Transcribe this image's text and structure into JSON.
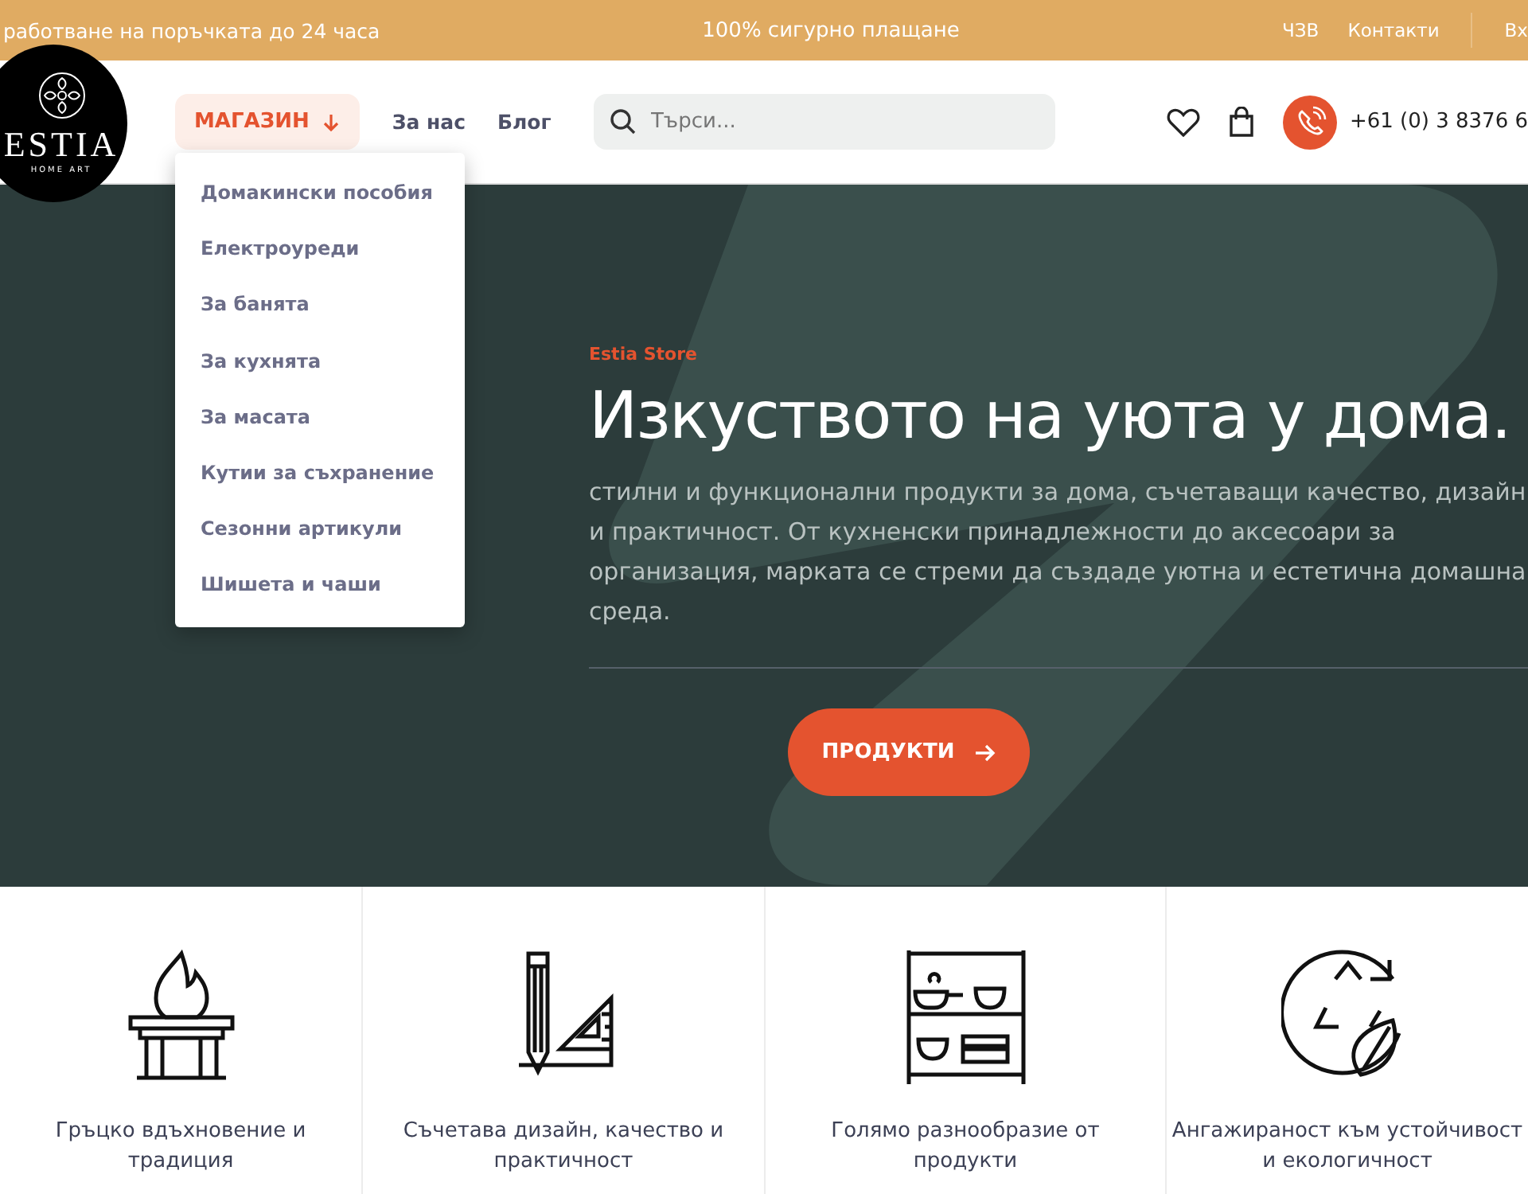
{
  "top_bar": {
    "left": "работване на поръчката до 24 часа",
    "center": "100% сигурно плащане",
    "links": [
      "ЧЗВ",
      "Контакти"
    ],
    "account": "Вх"
  },
  "header": {
    "logo": {
      "name": "ESTIA",
      "tagline": "HOME ART"
    },
    "nav": [
      {
        "label": "МАГАЗИН",
        "kind": "dropdown",
        "expanded": true
      },
      {
        "label": "За нас",
        "kind": "link"
      },
      {
        "label": "Блог",
        "kind": "link"
      }
    ],
    "search": {
      "placeholder": "Търси..."
    },
    "phone": "+61 (0) 3 8376 6"
  },
  "shop_menu": [
    "Домакински пособия",
    "Електроуреди",
    "За банята",
    "За кухнята",
    "За масата",
    "Кутии за съхранение",
    "Сезонни артикули",
    "Шишета и чаши"
  ],
  "hero": {
    "eyebrow": "Estia Store",
    "title": "Изкуството на уюта у дома.",
    "text": "стилни и функционални продукти за дома, съчетаващи качество, дизайн и практичност. От кухненски принадлежности до аксесоари за организация, марката се стреми да създаде уютна и естетична домашна среда.",
    "button": "ПРОДУКТИ"
  },
  "features": [
    {
      "kind": "fire",
      "text": "Гръцко вдъхновение и традиция"
    },
    {
      "kind": "tools",
      "text": "Съчетава дизайн, качество и практичност"
    },
    {
      "kind": "shelf",
      "text": "Голямо разнообразие от продукти"
    },
    {
      "kind": "recycle",
      "text": "Ангажираност към устойчивост и екологичност"
    }
  ]
}
